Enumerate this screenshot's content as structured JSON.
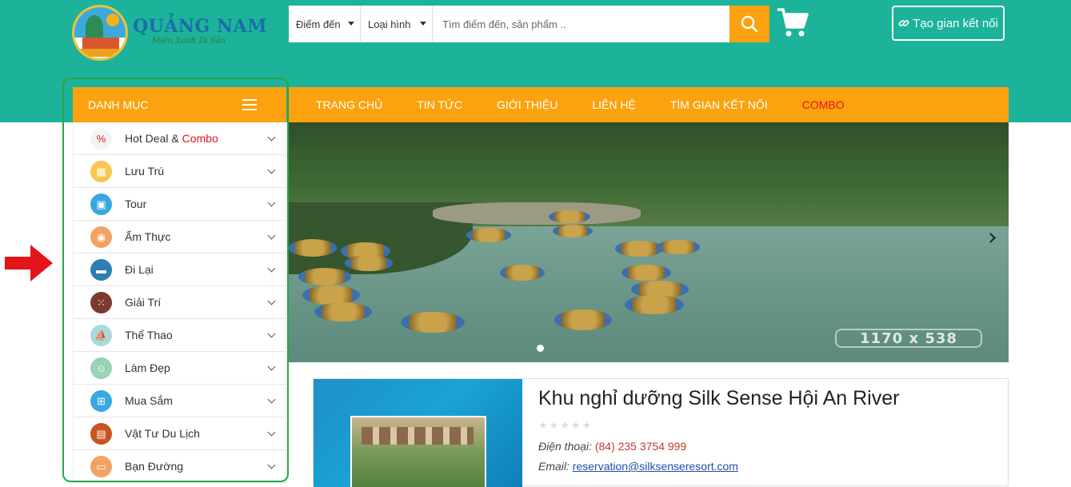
{
  "logo": {
    "title": "QUẢNG NAM",
    "subtitle": "Miền Xanh Di Sản"
  },
  "search": {
    "dest_label": "Điểm đến",
    "type_label": "Loại hình",
    "placeholder": "Tìm điểm đến, sản phẩm .."
  },
  "connect_button": "Tạo gian kết nối",
  "category_bar": {
    "label": "DANH MỤC"
  },
  "nav": [
    "TRANG CHỦ",
    "TIN TỨC",
    "GIỚI THIỆU",
    "LIÊN HỆ",
    "TÌM GIAN KẾT NỐI",
    "COMBO"
  ],
  "categories": [
    {
      "label": "Hot Deal & ",
      "label_highlight": "Combo",
      "icon": "hot-deal-icon",
      "color": "#f4f4f4"
    },
    {
      "label": "Lưu Trú",
      "icon": "hotel-icon",
      "color": "#f9c74f"
    },
    {
      "label": "Tour",
      "icon": "luggage-icon",
      "color": "#3ba7e0"
    },
    {
      "label": "Ẩm Thực",
      "icon": "dish-icon",
      "color": "#f4a261"
    },
    {
      "label": "Đi Lại",
      "icon": "car-icon",
      "color": "#2a7fb3"
    },
    {
      "label": "Giải Trí",
      "icon": "dice-icon",
      "color": "#7a3b2e"
    },
    {
      "label": "Thể Thao",
      "icon": "sailboat-icon",
      "color": "#a8dadc"
    },
    {
      "label": "Làm Đẹp",
      "icon": "beauty-icon",
      "color": "#9ad1b7"
    },
    {
      "label": "Mua Sắm",
      "icon": "shopping-cart-icon",
      "color": "#3ba7e0"
    },
    {
      "label": "Vật Tư Du Lịch",
      "icon": "suitcase-icon",
      "color": "#c9541f"
    },
    {
      "label": "Bạn Đường",
      "icon": "bus-icon",
      "color": "#f4a261"
    }
  ],
  "banner": {
    "watermark": "1170 x 538"
  },
  "listing": {
    "title": "Khu nghỉ dưỡng Silk Sense Hội An River",
    "rating": 0,
    "phone_label": "Điện thoại:",
    "phone": "(84) 235 3754 999",
    "email_label": "Email:",
    "email": "reservation@silksenseresort.com"
  },
  "colors": {
    "header_bg": "#1cb39a",
    "accent": "#fca20e",
    "highlight": "#e3151a",
    "outline": "#27a844",
    "arrow": "#e3151a"
  }
}
